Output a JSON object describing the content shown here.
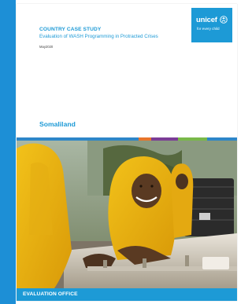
{
  "report": {
    "doc_type": "COUNTRY CASE STUDY",
    "title": "Evaluation of WASH Programming in Protracted Crises",
    "date": "May2020",
    "region": "Somaliland",
    "footer": "EVALUATION OFFICE"
  },
  "logo": {
    "name": "unicef",
    "tagline": "for every child",
    "emblem_icon": "unicef-emblem-icon"
  },
  "colors": {
    "brand_blue": "#1d9ad6",
    "sidebar_blue": "#1d8fd6",
    "strip": [
      "#2e86c8",
      "#2e86c8",
      "#2e86c8",
      "#e7752b",
      "#7b3d96",
      "#79b84a",
      "#79b84a",
      "#2e86c8"
    ]
  },
  "photo": {
    "subject": "cover-photo"
  }
}
